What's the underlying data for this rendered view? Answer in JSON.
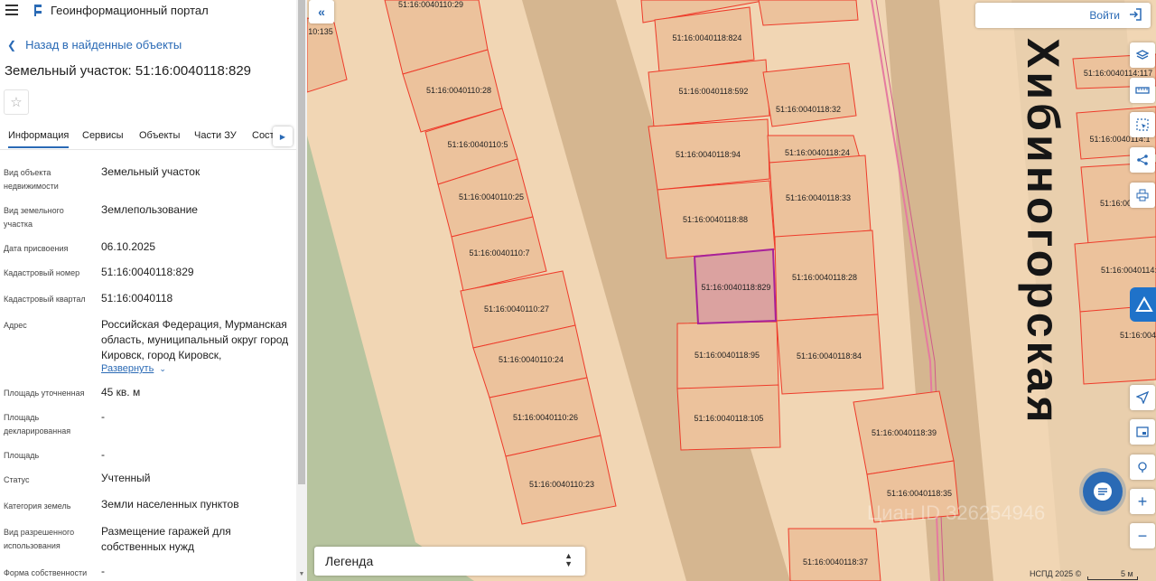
{
  "header": {
    "portal_title": "Геоинформационный портал"
  },
  "panel": {
    "back_label": "Назад в найденные объекты",
    "title": "Земельный участок: 51:16:0040118:829",
    "tabs": [
      {
        "label": "Информация",
        "active": true
      },
      {
        "label": "Сервисы"
      },
      {
        "label": "Объекты"
      },
      {
        "label": "Части ЗУ"
      },
      {
        "label": "Соста"
      }
    ],
    "properties": [
      {
        "label": "Вид объекта недвижимости",
        "value": "Земельный участок"
      },
      {
        "label": "Вид земельного участка",
        "value": "Землепользование"
      },
      {
        "label": "Дата присвоения",
        "value": "06.10.2025"
      },
      {
        "label": "Кадастровый номер",
        "value": "51:16:0040118:829"
      },
      {
        "label": "Кадастровый квартал",
        "value": "51:16:0040118"
      },
      {
        "label": "Адрес",
        "value": "Российская Федерация, Мурманская область, муниципальный округ город Кировск, город Кировск,"
      },
      {
        "label": "Площадь уточненная",
        "value": "45 кв. м"
      },
      {
        "label": "Площадь декларированная",
        "value": "-"
      },
      {
        "label": "Площадь",
        "value": "-"
      },
      {
        "label": "Статус",
        "value": "Учтенный"
      },
      {
        "label": "Категория земель",
        "value": "Земли населенных пунктов"
      },
      {
        "label": "Вид разрешенного использования",
        "value": "Размещение гаражей для собственных нужд"
      },
      {
        "label": "Форма собственности",
        "value": "-"
      }
    ],
    "expand_label": "Развернуть"
  },
  "map": {
    "login_label": "Войти",
    "legend_label": "Легенда",
    "street_name": "Хибиногорская",
    "attribution": "НСПД 2025 ©",
    "scale_label": "5 м",
    "watermark": "Циан ID 326254946",
    "selected_parcel": "51:16:0040118:829",
    "parcel_labels": [
      "10:135",
      "51:16:0040110:29",
      "51:16:0040110:28",
      "51:16:0040110:5",
      "51:16:0040110:25",
      "51:16:0040110:7",
      "51:16:0040110:27",
      "51:16:0040110:24",
      "51:16:0040110:26",
      "51:16:0040110:23",
      "51:16:0040118:824",
      "51:16:0040118:592",
      "51:16:0040118:94",
      "51:16:0040118:88",
      "51:16:0040118:829",
      "51:16:0040118:95",
      "51:16:0040118:105",
      "51:16:0040118:32",
      "51:16:0040118:24",
      "51:16:0040118:33",
      "51:16:0040118:28",
      "51:16:0040118:84",
      "51:16:0040118:39",
      "51:16:0040118:35",
      "51:16:0040118:37",
      "51:16:0040114:117",
      "51:16:0040114:1",
      "51:16:004",
      "51:16:0040114:",
      "51:16:004"
    ],
    "colors": {
      "background": "#f1d6b4",
      "parcel_fill": "#ecc29c",
      "parcel_border": "#ee3b2a",
      "selected_fill": "#dba2a0",
      "selected_border": "#a8229a",
      "green_area": "#b7c49f",
      "road_band": "#d5b690",
      "accent": "#2a6ab5"
    }
  }
}
